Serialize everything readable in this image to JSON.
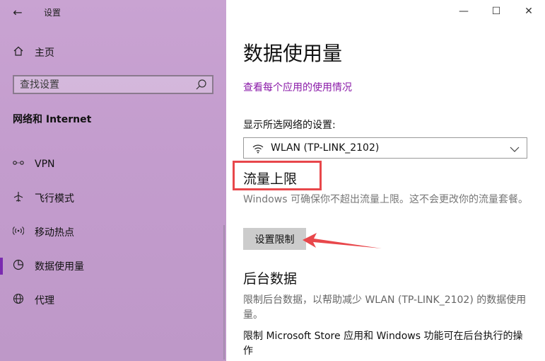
{
  "window": {
    "title": "设置",
    "controls": {
      "minimize": "—",
      "maximize": "☐",
      "close": "✕"
    }
  },
  "sidebar": {
    "home_label": "主页",
    "search_placeholder": "查找设置",
    "section_title": "网络和 Internet",
    "items": [
      {
        "id": "vpn",
        "label": "VPN",
        "icon": "vpn-icon"
      },
      {
        "id": "airplane",
        "label": "飞行模式",
        "icon": "airplane-icon"
      },
      {
        "id": "hotspot",
        "label": "移动热点",
        "icon": "hotspot-icon"
      },
      {
        "id": "data",
        "label": "数据使用量",
        "icon": "pie-chart-icon",
        "active": true
      },
      {
        "id": "proxy",
        "label": "代理",
        "icon": "globe-icon"
      }
    ]
  },
  "main": {
    "title": "数据使用量",
    "usage_link": "查看每个应用的使用情况",
    "network_label": "显示所选网络的设置:",
    "network_value": "WLAN (TP-LINK_2102)",
    "limit_heading": "流量上限",
    "limit_desc": "Windows 可确保你不超出流量上限。这不会更改你的流量套餐。",
    "set_limit_button": "设置限制",
    "background_heading": "后台数据",
    "background_desc": "限制后台数据，以帮助减少 WLAN (TP-LINK_2102) 的数据使用量。",
    "background_option": "限制 Microsoft Store 应用和 Windows 功能可在后台执行的操作"
  },
  "colors": {
    "sidebar_bg": "#c39ccd",
    "accent": "#7a2bb0",
    "link": "#8a1aa8",
    "highlight_box": "#e8474b"
  }
}
